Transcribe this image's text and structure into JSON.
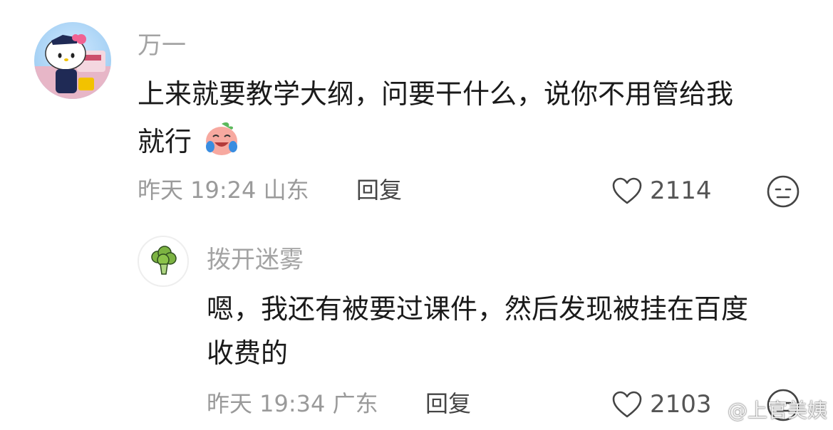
{
  "comments": [
    {
      "username": "万一",
      "line1": "上来就要教学大纲，问要干什么，说你不用管给我",
      "line2": "就行",
      "emoji": "crying-laughing-peach-emoji",
      "time": "昨天 19:24",
      "location": "山东",
      "reply_label": "回复",
      "likes": "2114",
      "avatar": "hello-kitty-avatar"
    },
    {
      "username": "拨开迷雾",
      "line1": "嗯，我还有被要过课件，然后发现被挂在百度",
      "line2": "收费的",
      "time": "昨天 19:34",
      "location": "广东",
      "reply_label": "回复",
      "likes": "2103",
      "avatar": "broccoli-avatar"
    }
  ],
  "watermark": "@上官美姨",
  "colors": {
    "text": "#1a1a1a",
    "muted": "#a3a3a3",
    "meta": "#9a9a9a"
  }
}
